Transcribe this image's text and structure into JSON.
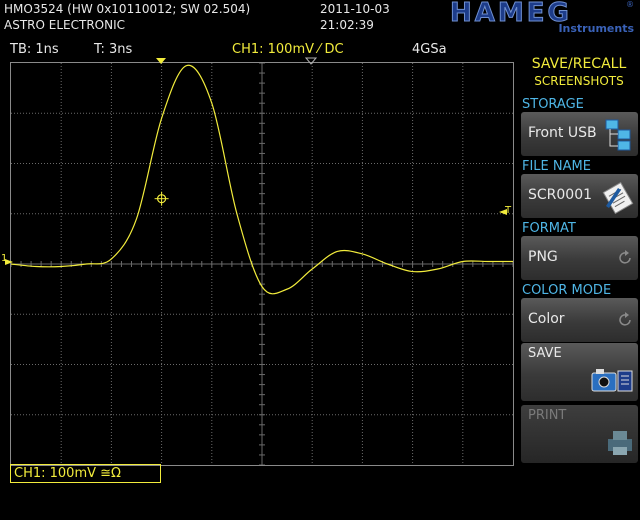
{
  "header": {
    "model_line": "HMO3524 (HW 0x10110012; SW 02.504)",
    "company": "ASTRO ELECTRONIC",
    "date": "2011-10-03",
    "time": "21:02:39",
    "logo_text": "HAMEG",
    "logo_sub": "Instruments",
    "logo_registered": "®"
  },
  "status_bar": {
    "timebase": "TB: 1ns",
    "trigger_time": "T: 3ns",
    "channel": "CH1: 100mV ⁄ DC",
    "sample_rate": "4GSa"
  },
  "side_menu": {
    "title": "SAVE/RECALL",
    "subtitle": "SCREENSHOTS",
    "storage_label": "STORAGE",
    "storage_value": "Front USB",
    "filename_label": "FILE NAME",
    "filename_value": "SCR0001",
    "format_label": "FORMAT",
    "format_value": "PNG",
    "colormode_label": "COLOR MODE",
    "colormode_value": "Color",
    "save_label": "SAVE",
    "print_label": "PRINT"
  },
  "channel_box": "CH1: 100mV ≅Ω",
  "markers": {
    "ch1_level": "1",
    "trigger": "T"
  },
  "colors": {
    "trace": "#f2ec3c",
    "accent": "#4fb6e6",
    "grid": "#6a6a6a"
  },
  "chart_data": {
    "type": "line",
    "title": "",
    "xlabel": "",
    "ylabel": "",
    "x_divisions": 10,
    "y_divisions": 8,
    "x_unit_per_div": "1ns",
    "y_unit_per_div": "100mV",
    "xlim": [
      -5,
      5
    ],
    "ylim": [
      -4,
      4
    ],
    "grid": true,
    "series": [
      {
        "x": [
          -5,
          -4.5,
          -4,
          -3.5,
          -3,
          -2.5,
          -2,
          -1.5,
          -1,
          -0.5,
          0,
          0.5,
          1,
          1.5,
          2,
          2.5,
          3,
          3.5,
          4,
          4.5,
          5
        ],
        "y": [
          0,
          -0.05,
          -0.05,
          0,
          0.1,
          0.9,
          2.9,
          3.95,
          3.2,
          1.0,
          -0.45,
          -0.5,
          -0.1,
          0.25,
          0.2,
          0,
          -0.15,
          -0.1,
          0.05,
          0.05,
          0.05
        ]
      }
    ]
  }
}
